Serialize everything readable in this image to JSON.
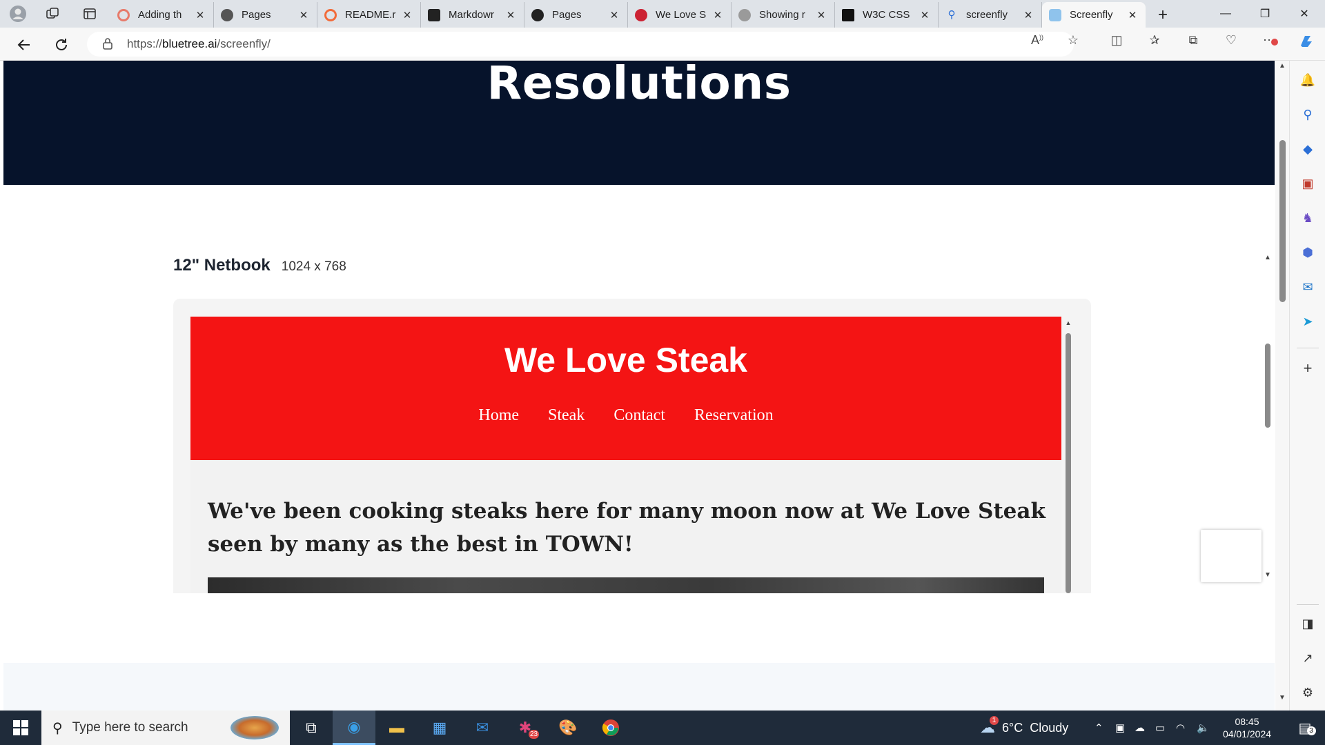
{
  "browser": {
    "tabs": [
      {
        "title": "Adding th",
        "favicon_color": "#e77a6a"
      },
      {
        "title": "Pages",
        "favicon_color": "#555555"
      },
      {
        "title": "README.r",
        "favicon_color": "#f26b3a"
      },
      {
        "title": "Markdowr",
        "favicon_color": "#222222"
      },
      {
        "title": "Pages",
        "favicon_color": "#222222"
      },
      {
        "title": "We Love S",
        "favicon_color": "#cc2233"
      },
      {
        "title": "Showing r",
        "favicon_color": "#888888"
      },
      {
        "title": "W3C CSS",
        "favicon_color": "#111111"
      },
      {
        "title": "screenfly",
        "favicon_color": "#2b6fd6"
      },
      {
        "title": "Screenfly",
        "favicon_color": "#8fc3ec"
      }
    ],
    "active_tab_index": 9,
    "new_tab_symbol": "+",
    "url_prefix": "https://",
    "url_host": "bluetree.ai",
    "url_path": "/screenfly/"
  },
  "page": {
    "hero_title": "Resolutions",
    "device_name": "12\" Netbook",
    "device_resolution": "1024 x 768",
    "site": {
      "brand": "We Love Steak",
      "nav": [
        "Home",
        "Steak",
        "Contact",
        "Reservation"
      ],
      "tagline": "We've been cooking steaks here for many moon now at We Love Steak seen by many as the best in TOWN!"
    }
  },
  "taskbar": {
    "search_placeholder": "Type here to search",
    "weather": "6°C  Cloudy",
    "weather_badge": "1",
    "time": "08:45",
    "date": "04/01/2024",
    "notification_count": "3",
    "app_badge": "23"
  },
  "colors": {
    "hero_bg": "#06132b",
    "site_header_bg": "#f41414",
    "taskbar_bg": "#1f2b3a"
  }
}
